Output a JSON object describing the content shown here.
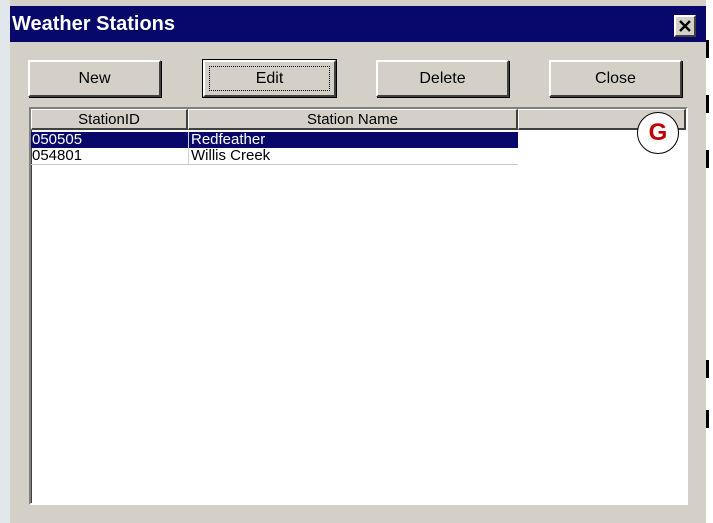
{
  "window": {
    "title": "Weather Stations"
  },
  "toolbar": {
    "new_label": "New",
    "edit_label": "Edit",
    "delete_label": "Delete",
    "close_label": "Close"
  },
  "table": {
    "columns": [
      "StationID",
      "Station Name",
      ""
    ],
    "rows": [
      {
        "id": "050505",
        "name": "Redfeather",
        "selected": true
      },
      {
        "id": "054801",
        "name": "Willis Creek",
        "selected": false
      }
    ]
  },
  "annotation": {
    "label": "G"
  },
  "colors": {
    "titlebar": "#08086b",
    "selection": "#08086b",
    "annotation_text": "#c00000",
    "window_bg": "#d4d0c8"
  },
  "icons": {
    "close": "close-icon"
  }
}
